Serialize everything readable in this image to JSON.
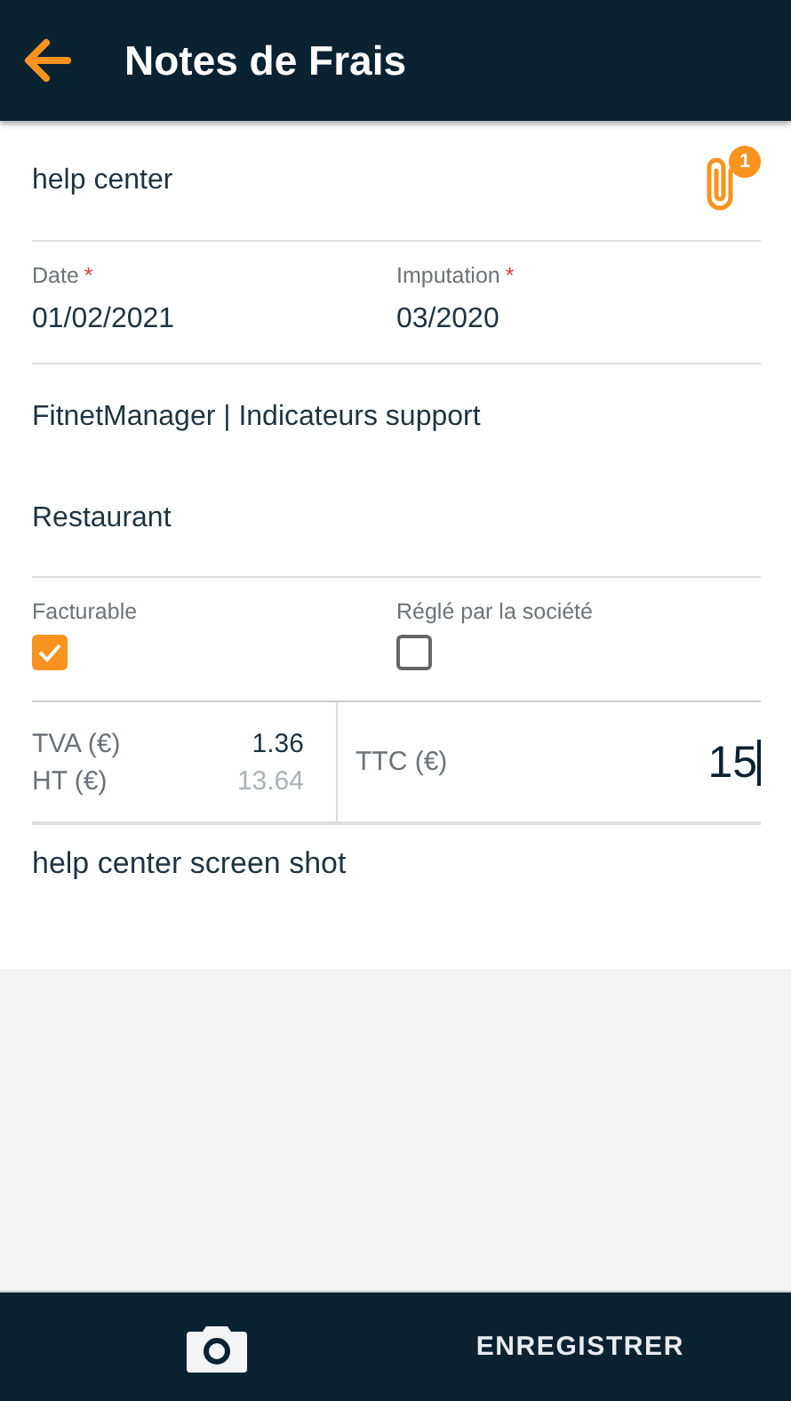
{
  "header": {
    "title": "Notes de Frais"
  },
  "subject": {
    "value": "help center",
    "attachments": "1"
  },
  "date": {
    "label": "Date",
    "required_mark": "*",
    "value": "01/02/2021"
  },
  "imputation": {
    "label": "Imputation",
    "required_mark": "*",
    "value": "03/2020"
  },
  "project": {
    "value": "FitnetManager | Indicateurs support"
  },
  "category": {
    "value": "Restaurant"
  },
  "checkboxes": [
    {
      "label": "Facturable",
      "checked": true
    },
    {
      "label": "Réglé par la société",
      "checked": false
    }
  ],
  "amounts": [
    {
      "label": "TVA (€)",
      "value": "1.36",
      "disabled": false
    },
    {
      "label": "HT (€)",
      "value": "13.64",
      "disabled": true
    }
  ],
  "total": {
    "label": "TTC (€)",
    "value": "15"
  },
  "comment": {
    "value": "help center screen shot"
  },
  "bottom_bar": {
    "save_label": "ENREGISTRER"
  }
}
